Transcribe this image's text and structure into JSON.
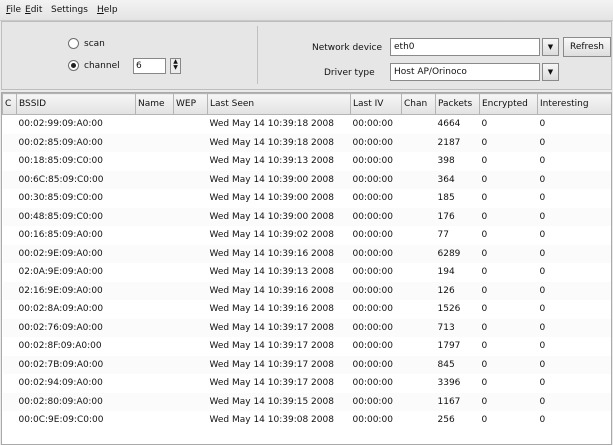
{
  "menu": {
    "file_first": "F",
    "file_rest": "ile",
    "edit_first": "E",
    "edit_rest": "dit",
    "settings": "Settings",
    "help_first": "H",
    "help_rest": "elp"
  },
  "controls": {
    "scan_label": "scan",
    "channel_label": "channel",
    "channel_value": "6",
    "network_device_label": "Network device",
    "network_device_value": "eth0",
    "driver_type_label": "Driver type",
    "driver_type_value": "Host AP/Orinoco",
    "refresh_label": "Refresh",
    "mode_selected": "channel"
  },
  "table": {
    "headers": [
      "C",
      "BSSID",
      "Name",
      "WEP",
      "Last Seen",
      "Last IV",
      "Chan",
      "Packets",
      "Encrypted",
      "Interesting"
    ],
    "rows": [
      [
        "",
        "00:02:99:09:A0:00",
        "",
        "",
        "Wed May 14 10:39:18 2008",
        "00:00:00",
        "",
        "4664",
        "0",
        "0"
      ],
      [
        "",
        "00:02:85:09:A0:00",
        "",
        "",
        "Wed May 14 10:39:18 2008",
        "00:00:00",
        "",
        "2187",
        "0",
        "0"
      ],
      [
        "",
        "00:18:85:09:C0:00",
        "",
        "",
        "Wed May 14 10:39:13 2008",
        "00:00:00",
        "",
        "398",
        "0",
        "0"
      ],
      [
        "",
        "00:6C:85:09:C0:00",
        "",
        "",
        "Wed May 14 10:39:00 2008",
        "00:00:00",
        "",
        "364",
        "0",
        "0"
      ],
      [
        "",
        "00:30:85:09:C0:00",
        "",
        "",
        "Wed May 14 10:39:00 2008",
        "00:00:00",
        "",
        "185",
        "0",
        "0"
      ],
      [
        "",
        "00:48:85:09:C0:00",
        "",
        "",
        "Wed May 14 10:39:00 2008",
        "00:00:00",
        "",
        "176",
        "0",
        "0"
      ],
      [
        "",
        "00:16:85:09:A0:00",
        "",
        "",
        "Wed May 14 10:39:02 2008",
        "00:00:00",
        "",
        "77",
        "0",
        "0"
      ],
      [
        "",
        "00:02:9E:09:A0:00",
        "",
        "",
        "Wed May 14 10:39:16 2008",
        "00:00:00",
        "",
        "6289",
        "0",
        "0"
      ],
      [
        "",
        "02:0A:9E:09:A0:00",
        "",
        "",
        "Wed May 14 10:39:13 2008",
        "00:00:00",
        "",
        "194",
        "0",
        "0"
      ],
      [
        "",
        "02:16:9E:09:A0:00",
        "",
        "",
        "Wed May 14 10:39:16 2008",
        "00:00:00",
        "",
        "126",
        "0",
        "0"
      ],
      [
        "",
        "00:02:8A:09:A0:00",
        "",
        "",
        "Wed May 14 10:39:16 2008",
        "00:00:00",
        "",
        "1526",
        "0",
        "0"
      ],
      [
        "",
        "00:02:76:09:A0:00",
        "",
        "",
        "Wed May 14 10:39:17 2008",
        "00:00:00",
        "",
        "713",
        "0",
        "0"
      ],
      [
        "",
        "00:02:8F:09:A0:00",
        "",
        "",
        "Wed May 14 10:39:17 2008",
        "00:00:00",
        "",
        "1797",
        "0",
        "0"
      ],
      [
        "",
        "00:02:7B:09:A0:00",
        "",
        "",
        "Wed May 14 10:39:17 2008",
        "00:00:00",
        "",
        "845",
        "0",
        "0"
      ],
      [
        "",
        "00:02:94:09:A0:00",
        "",
        "",
        "Wed May 14 10:39:17 2008",
        "00:00:00",
        "",
        "3396",
        "0",
        "0"
      ],
      [
        "",
        "00:02:80:09:A0:00",
        "",
        "",
        "Wed May 14 10:39:15 2008",
        "00:00:00",
        "",
        "1167",
        "0",
        "0"
      ],
      [
        "",
        "00:0C:9E:09:C0:00",
        "",
        "",
        "Wed May 14 10:39:08 2008",
        "00:00:00",
        "",
        "256",
        "0",
        "0"
      ]
    ]
  }
}
